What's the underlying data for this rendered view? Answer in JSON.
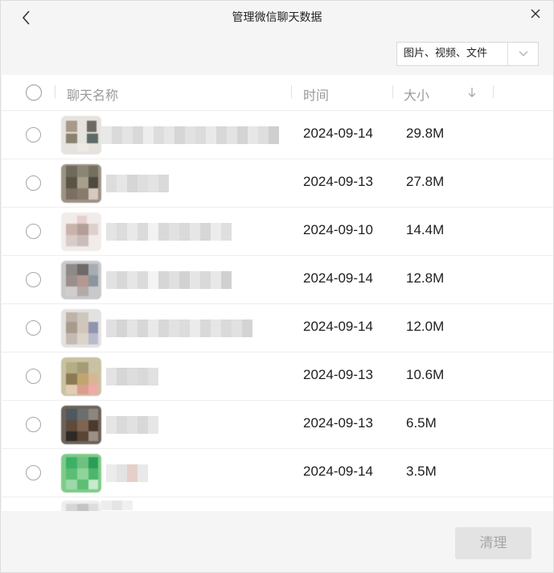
{
  "window": {
    "title": "管理微信聊天数据",
    "back_icon": "chevron-left-icon",
    "close_icon": "close-icon"
  },
  "filter": {
    "selected": "图片、视频、文件",
    "dropdown_icon": "chevron-down-icon"
  },
  "table": {
    "columns": [
      "聊天名称",
      "时间",
      "大小"
    ],
    "sort_icon": "arrow-down-icon",
    "rows": [
      {
        "date": "2024-09-14",
        "size": "29.8M"
      },
      {
        "date": "2024-09-13",
        "size": "27.8M"
      },
      {
        "date": "2024-09-10",
        "size": "14.4M"
      },
      {
        "date": "2024-09-14",
        "size": "12.8M"
      },
      {
        "date": "2024-09-14",
        "size": "12.0M"
      },
      {
        "date": "2024-09-13",
        "size": "10.6M"
      },
      {
        "date": "2024-09-13",
        "size": "6.5M"
      },
      {
        "date": "2024-09-14",
        "size": "3.5M"
      }
    ]
  },
  "footer": {
    "clean_label": "清理"
  },
  "colors": {
    "background": "#f5f5f5",
    "list_background": "#ffffff",
    "disabled_button": "#e3e3e3"
  }
}
